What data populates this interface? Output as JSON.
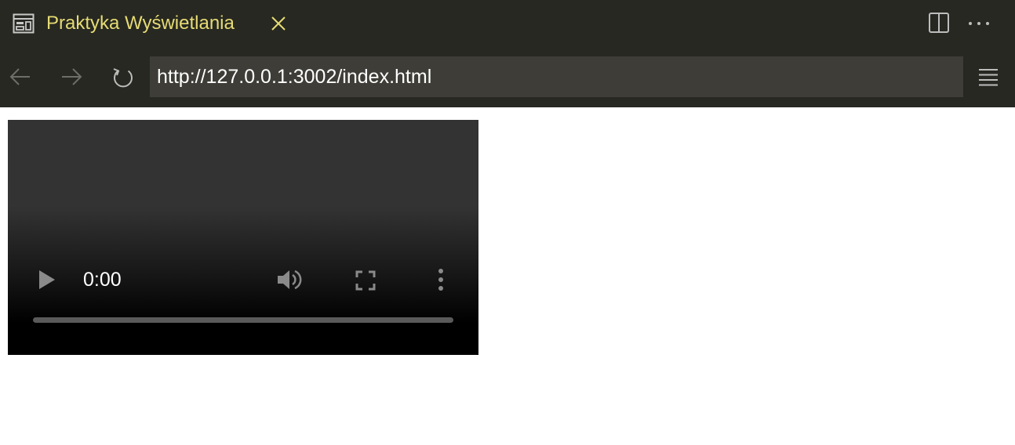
{
  "tab": {
    "title": "Praktyka Wyświetlania",
    "icon": "preview-icon",
    "active_color": "#e6db74"
  },
  "toolbar": {
    "split_icon": "split-editor-icon",
    "more_icon": "ellipsis-icon"
  },
  "nav": {
    "url": "http://127.0.0.1:3002/index.html",
    "back_icon": "arrow-left-icon",
    "forward_icon": "arrow-right-icon",
    "reload_icon": "reload-icon",
    "menu_icon": "hamburger-menu-icon"
  },
  "video": {
    "current_time": "0:00",
    "progress_fraction": 0,
    "play_icon": "play-icon",
    "volume_icon": "volume-icon",
    "fullscreen_icon": "fullscreen-icon",
    "options_icon": "more-vertical-icon"
  },
  "colors": {
    "chrome_bg": "#272822",
    "url_bg": "#3e3d37",
    "accent": "#e6db74"
  }
}
